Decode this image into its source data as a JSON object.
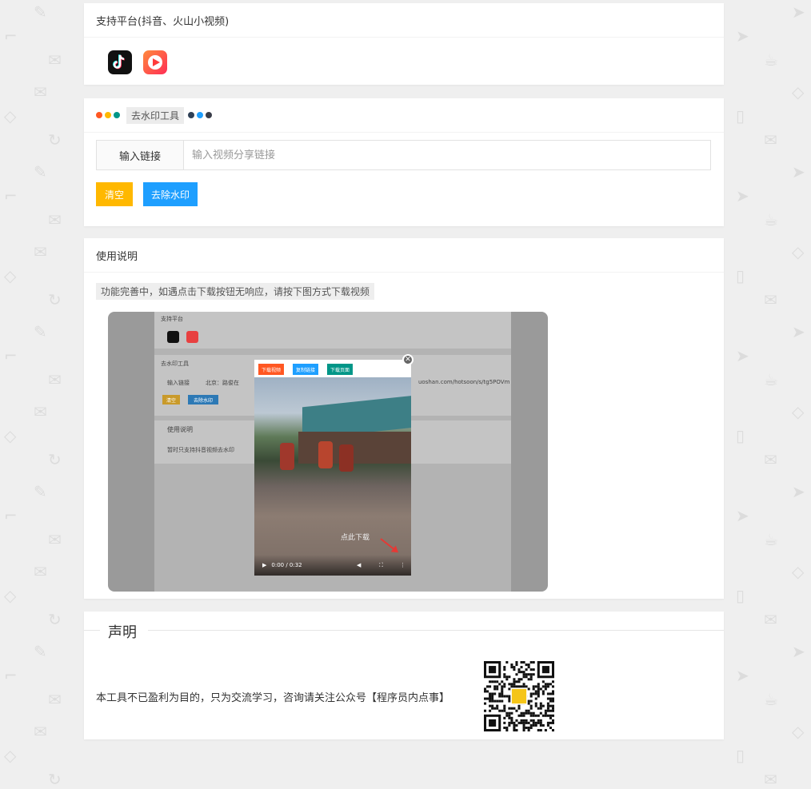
{
  "platform_card": {
    "title": "支持平台(抖音、火山小视频)",
    "apps": [
      {
        "icon": "tiktok-icon"
      },
      {
        "icon": "huoshan-icon"
      }
    ]
  },
  "tool_card": {
    "title": "去水印工具",
    "dots_left": [
      "#ff5722",
      "#ffb800",
      "#009688"
    ],
    "dots_right": [
      "#2f4056",
      "#1e9fff",
      "#393d49"
    ],
    "input_label": "输入链接",
    "input_placeholder": "输入视频分享链接",
    "input_value": "",
    "clear_button": "清空",
    "remove_button": "去除水印",
    "colors": {
      "clear": "#ffb800",
      "remove": "#1e9fff"
    }
  },
  "usage_card": {
    "title": "使用说明",
    "note": "功能完善中，如遇点击下载按钮无响应，请按下图方式下载视频",
    "demo": {
      "platform_title": "支持平台",
      "tool_title": "去水印工具",
      "input_label": "输入链接",
      "input_value_start": "北京：路俊在",
      "input_value_end": "uoshan.com/hotsoon/s/tg5POVm",
      "clear_button": "清空",
      "remove_button": "去除水印",
      "usage_title": "使用说明",
      "usage_item": "暂时只支持抖音视频去水印",
      "modal_buttons": [
        "下载视频",
        "复制链接",
        "下载页面"
      ],
      "modal_button_colors": [
        "#ff5722",
        "#1e9fff",
        "#009688"
      ],
      "video_time": "0:00 / 0:32",
      "download_hint": "点此下载",
      "close_symbol": "✕"
    }
  },
  "statement_card": {
    "legend": "声明",
    "text": "本工具不已盈利为目的，只为交流学习，咨询请关注公众号【程序员内点事】"
  }
}
